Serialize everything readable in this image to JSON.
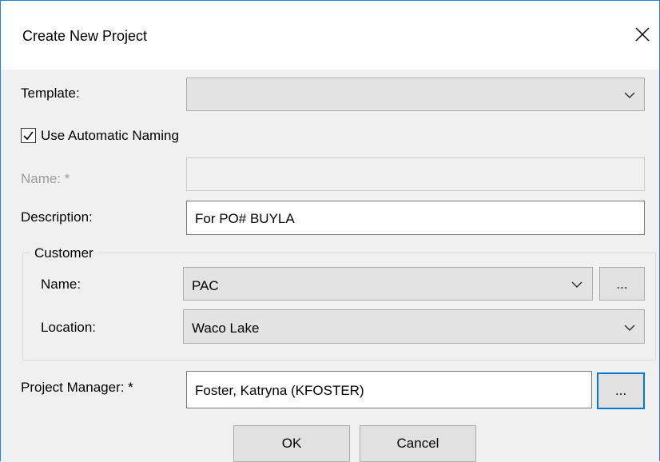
{
  "dialog": {
    "title": "Create New Project",
    "close_icon": "close-icon"
  },
  "template": {
    "label": "Template:",
    "value": ""
  },
  "auto_naming": {
    "label": "Use Automatic Naming",
    "checked": true
  },
  "name": {
    "label": "Name:  *",
    "value": "",
    "enabled": false
  },
  "description": {
    "label": "Description:",
    "value": "For PO# BUYLA"
  },
  "customer": {
    "group_label": "Customer",
    "name_label": "Name:",
    "name_value": "PAC",
    "browse_label": "...",
    "location_label": "Location:",
    "location_value": "Waco Lake"
  },
  "project_manager": {
    "label": "Project Manager: *",
    "value": "Foster, Katryna (KFOSTER)",
    "browse_label": "..."
  },
  "buttons": {
    "ok": "OK",
    "cancel": "Cancel"
  }
}
